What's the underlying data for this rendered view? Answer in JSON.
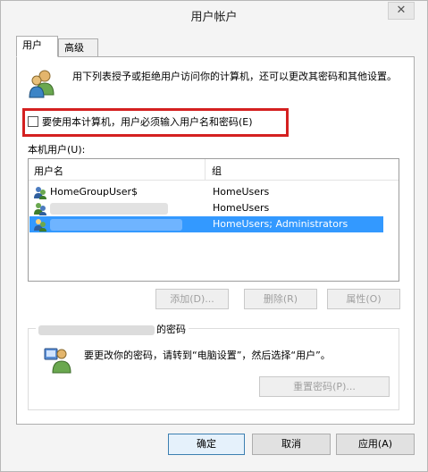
{
  "window": {
    "title": "用户帐户",
    "close_glyph": "✕"
  },
  "tabs": [
    {
      "label": "用户",
      "active": true
    },
    {
      "label": "高级",
      "active": false
    }
  ],
  "intro": {
    "icon": "users-icon",
    "text": "用下列表授予或拒绝用户访问你的计算机，还可以更改其密码和其他设置。"
  },
  "require_login": {
    "label": "要使用本计算机，用户必须输入用户名和密码(E)",
    "checked": false,
    "highlight_color": "#d42020"
  },
  "local_users": {
    "label": "本机用户(U):",
    "columns": [
      "用户名",
      "组"
    ],
    "rows": [
      {
        "name": "HomeGroupUser$",
        "group": "HomeUsers",
        "selected": false
      },
      {
        "name": "",
        "group": "HomeUsers",
        "selected": false
      },
      {
        "name": "",
        "group": "HomeUsers; Administrators",
        "selected": true
      }
    ],
    "selection_color": "#3399ff"
  },
  "list_buttons": {
    "add": "添加(D)...",
    "delete": "删除(R)",
    "properties": "属性(O)"
  },
  "password": {
    "legend_suffix": "的密码",
    "icon": "user-key-icon",
    "text": "要更改你的密码，请转到“电脑设置”，然后选择“用户”。",
    "reset_button": "重置密码(P)..."
  },
  "dialog_buttons": {
    "ok": "确定",
    "cancel": "取消",
    "apply": "应用(A)"
  }
}
